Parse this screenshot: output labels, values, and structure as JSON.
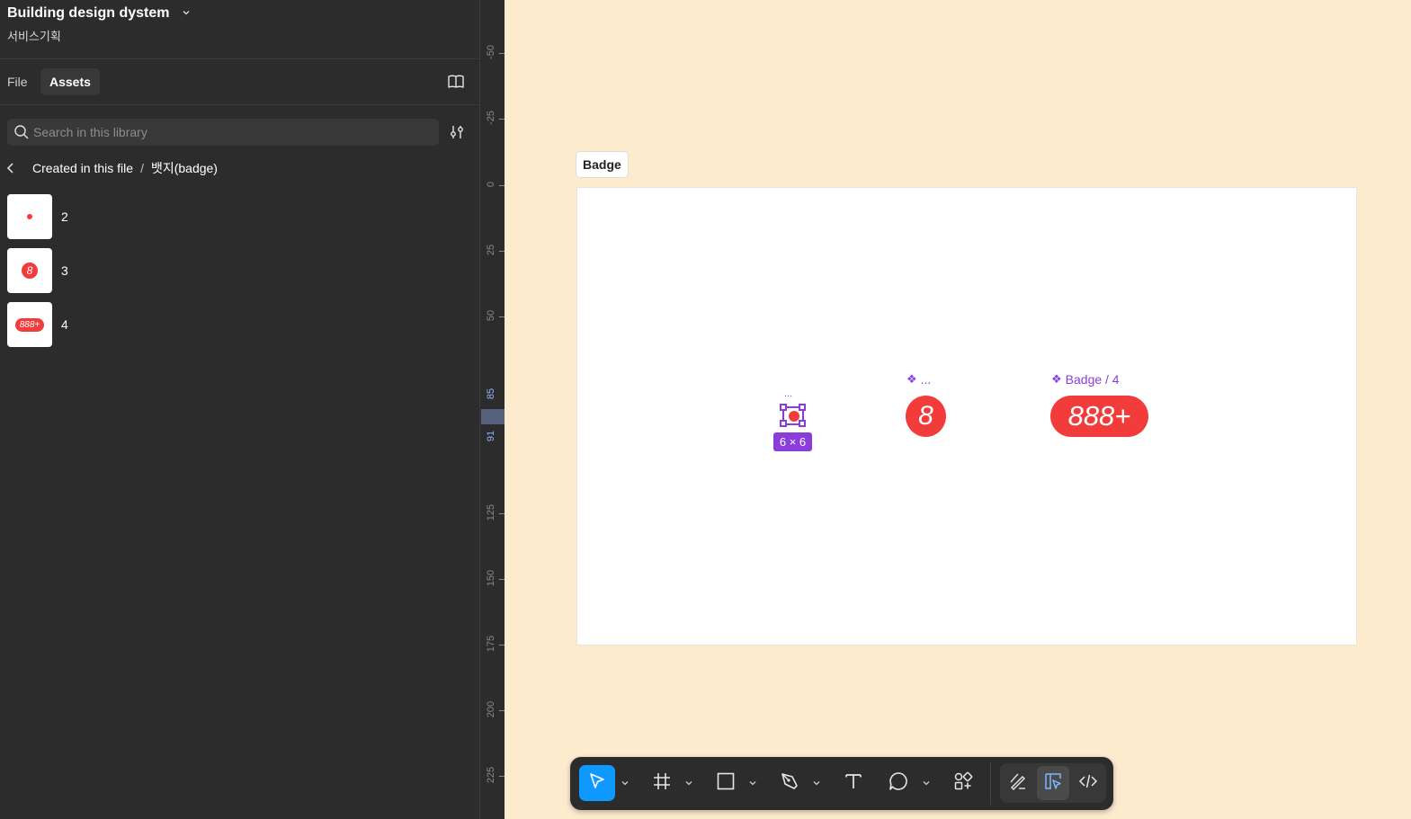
{
  "file": {
    "title": "Building design dystem",
    "team": "서비스기획"
  },
  "tabs": [
    {
      "label": "File",
      "active": false
    },
    {
      "label": "Assets",
      "active": true
    }
  ],
  "search": {
    "placeholder": "Search in this library",
    "value": ""
  },
  "breadcrumb": {
    "root": "Created in this file",
    "separator": "/",
    "current": "뱃지(badge)"
  },
  "assets": [
    {
      "label": "2",
      "preview": "dot"
    },
    {
      "label": "3",
      "preview": "8"
    },
    {
      "label": "4",
      "preview": "888+"
    }
  ],
  "ruler": {
    "ticks": [
      "-50",
      "-25",
      "0",
      "25",
      "50",
      "85",
      "91",
      "125",
      "150",
      "175",
      "200",
      "225"
    ],
    "selection_start": "85",
    "selection_end": "91"
  },
  "canvas": {
    "frame_label": "Badge",
    "dot_badge": {
      "name": "...",
      "size_tag": "6 × 6"
    },
    "number_badge": {
      "name": "...",
      "text": "8"
    },
    "pill_badge": {
      "name": "Badge / 4",
      "text": "888+"
    }
  },
  "colors": {
    "canvas_bg": "#fdebce",
    "panel_bg": "#2c2c2c",
    "badge_red": "#f23c3c",
    "component_purple": "#8b3ddb",
    "tool_active_blue": "#0d99ff"
  },
  "toolbar": {
    "tools": [
      {
        "icon": "move-icon",
        "active": true
      },
      {
        "icon": "frame-icon",
        "active": false
      },
      {
        "icon": "rectangle-icon",
        "active": false
      },
      {
        "icon": "pen-icon",
        "active": false
      },
      {
        "icon": "text-icon",
        "active": false
      },
      {
        "icon": "comment-icon",
        "active": false
      },
      {
        "icon": "actions-icon",
        "active": false
      },
      {
        "icon": "draw-mode-icon",
        "active": false
      },
      {
        "icon": "design-mode-icon",
        "active": true
      },
      {
        "icon": "dev-mode-icon",
        "active": false
      }
    ]
  }
}
